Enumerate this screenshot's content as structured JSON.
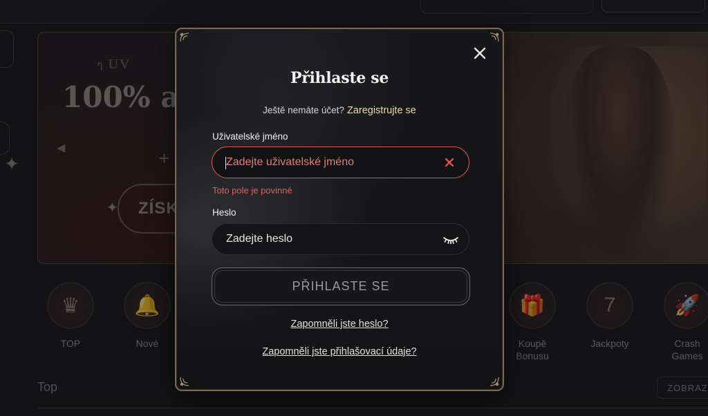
{
  "background": {
    "banner_subtitle": "UV",
    "banner_title": "100% až",
    "banner_button": "ZÍSK",
    "categories": [
      {
        "label": "TOP",
        "icon": "crown-icon",
        "glyph": "♛"
      },
      {
        "label": "Nové",
        "icon": "bell-icon",
        "glyph": "🔔"
      },
      {
        "label": "Koupě Bonusu",
        "icon": "gift-icon",
        "glyph": "🎁"
      },
      {
        "label": "Jackpoty",
        "icon": "seven-icon",
        "glyph": "7"
      },
      {
        "label": "Crash Games",
        "icon": "rocket-icon",
        "glyph": "🚀"
      }
    ],
    "section_title": "Top",
    "show_button": "ZOBRAZ"
  },
  "modal": {
    "title": "Přihlaste se",
    "register_question": "Ještě nemáte účet?",
    "register_link": "Zaregistrujte se",
    "username": {
      "label": "Uživatelské jméno",
      "placeholder": "Zadejte uživatelské jméno",
      "value": "",
      "error": "Toto pole je povinné"
    },
    "password": {
      "label": "Heslo",
      "placeholder": "Zadejte heslo",
      "value": ""
    },
    "submit_label": "PŘIHLASTE SE",
    "forgot_password": "Zapomněli jste heslo?",
    "forgot_credentials": "Zapomněli jste přihlašovací údaje?"
  },
  "colors": {
    "accent_gold": "#f0d9a8",
    "error_red": "#d9534f",
    "modal_border": "#7a6a52"
  }
}
